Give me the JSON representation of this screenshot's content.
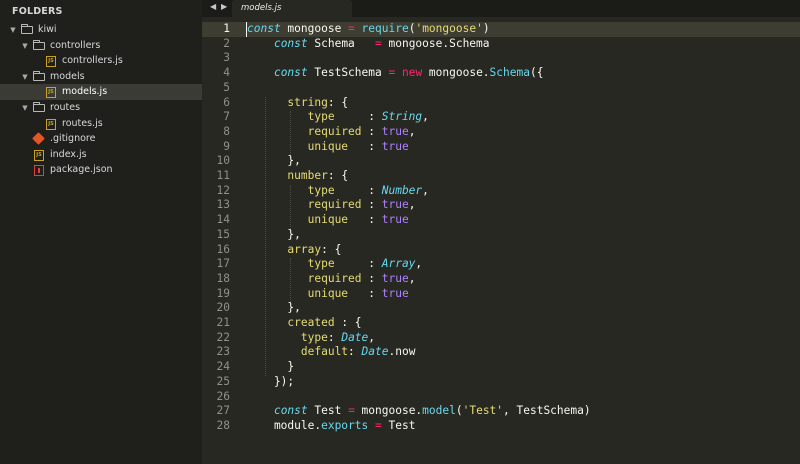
{
  "sidebar": {
    "title": "FOLDERS",
    "tree": [
      {
        "label": "kiwi",
        "kind": "folder",
        "depth": 0,
        "expanded": true,
        "selected": false
      },
      {
        "label": "controllers",
        "kind": "folder",
        "depth": 1,
        "expanded": true,
        "selected": false
      },
      {
        "label": "controllers.js",
        "kind": "js",
        "depth": 2,
        "selected": false
      },
      {
        "label": "models",
        "kind": "folder",
        "depth": 1,
        "expanded": true,
        "selected": false
      },
      {
        "label": "models.js",
        "kind": "js",
        "depth": 2,
        "selected": true
      },
      {
        "label": "routes",
        "kind": "folder",
        "depth": 1,
        "expanded": true,
        "selected": false
      },
      {
        "label": "routes.js",
        "kind": "js",
        "depth": 2,
        "selected": false
      },
      {
        "label": ".gitignore",
        "kind": "git",
        "depth": 1,
        "selected": false
      },
      {
        "label": "index.js",
        "kind": "js",
        "depth": 1,
        "selected": false
      },
      {
        "label": "package.json",
        "kind": "json",
        "depth": 1,
        "selected": false
      }
    ]
  },
  "tabbar": {
    "back_icon": "◀",
    "forward_icon": "▶",
    "tab_label": "models.js"
  },
  "editor": {
    "current_line": 1,
    "lines": [
      [
        [
          "kw-i",
          "const"
        ],
        [
          "plain",
          " mongoose "
        ],
        [
          "op",
          "="
        ],
        [
          "plain",
          " "
        ],
        [
          "fn",
          "require"
        ],
        [
          "plain",
          "("
        ],
        [
          "str",
          "'mongoose'"
        ],
        [
          "plain",
          ")"
        ]
      ],
      [
        [
          "plain",
          "    "
        ],
        [
          "kw-i",
          "const"
        ],
        [
          "plain",
          " Schema   "
        ],
        [
          "op",
          "="
        ],
        [
          "plain",
          " mongoose.Schema"
        ]
      ],
      [
        [
          "plain",
          ""
        ]
      ],
      [
        [
          "plain",
          "    "
        ],
        [
          "kw-i",
          "const"
        ],
        [
          "plain",
          " TestSchema "
        ],
        [
          "op",
          "="
        ],
        [
          "plain",
          " "
        ],
        [
          "kw",
          "new"
        ],
        [
          "plain",
          " mongoose."
        ],
        [
          "fn",
          "Schema"
        ],
        [
          "plain",
          "({"
        ]
      ],
      [
        [
          "plain",
          ""
        ]
      ],
      [
        [
          "plain",
          "      "
        ],
        [
          "key",
          "string"
        ],
        [
          "plain",
          ": {"
        ]
      ],
      [
        [
          "plain",
          "         "
        ],
        [
          "key",
          "type"
        ],
        [
          "plain",
          "     : "
        ],
        [
          "type",
          "String"
        ],
        [
          "plain",
          ","
        ]
      ],
      [
        [
          "plain",
          "         "
        ],
        [
          "key",
          "required"
        ],
        [
          "plain",
          " : "
        ],
        [
          "bool",
          "true"
        ],
        [
          "plain",
          ","
        ]
      ],
      [
        [
          "plain",
          "         "
        ],
        [
          "key",
          "unique"
        ],
        [
          "plain",
          "   : "
        ],
        [
          "bool",
          "true"
        ]
      ],
      [
        [
          "plain",
          "      },"
        ]
      ],
      [
        [
          "plain",
          "      "
        ],
        [
          "key",
          "number"
        ],
        [
          "plain",
          ": {"
        ]
      ],
      [
        [
          "plain",
          "         "
        ],
        [
          "key",
          "type"
        ],
        [
          "plain",
          "     : "
        ],
        [
          "type",
          "Number"
        ],
        [
          "plain",
          ","
        ]
      ],
      [
        [
          "plain",
          "         "
        ],
        [
          "key",
          "required"
        ],
        [
          "plain",
          " : "
        ],
        [
          "bool",
          "true"
        ],
        [
          "plain",
          ","
        ]
      ],
      [
        [
          "plain",
          "         "
        ],
        [
          "key",
          "unique"
        ],
        [
          "plain",
          "   : "
        ],
        [
          "bool",
          "true"
        ]
      ],
      [
        [
          "plain",
          "      },"
        ]
      ],
      [
        [
          "plain",
          "      "
        ],
        [
          "key",
          "array"
        ],
        [
          "plain",
          ": {"
        ]
      ],
      [
        [
          "plain",
          "         "
        ],
        [
          "key",
          "type"
        ],
        [
          "plain",
          "     : "
        ],
        [
          "type",
          "Array"
        ],
        [
          "plain",
          ","
        ]
      ],
      [
        [
          "plain",
          "         "
        ],
        [
          "key",
          "required"
        ],
        [
          "plain",
          " : "
        ],
        [
          "bool",
          "true"
        ],
        [
          "plain",
          ","
        ]
      ],
      [
        [
          "plain",
          "         "
        ],
        [
          "key",
          "unique"
        ],
        [
          "plain",
          "   : "
        ],
        [
          "bool",
          "true"
        ]
      ],
      [
        [
          "plain",
          "      },"
        ]
      ],
      [
        [
          "plain",
          "      "
        ],
        [
          "key",
          "created"
        ],
        [
          "plain",
          " : {"
        ]
      ],
      [
        [
          "plain",
          "        "
        ],
        [
          "key",
          "type"
        ],
        [
          "plain",
          ": "
        ],
        [
          "type",
          "Date"
        ],
        [
          "plain",
          ","
        ]
      ],
      [
        [
          "plain",
          "        "
        ],
        [
          "key",
          "default"
        ],
        [
          "plain",
          ": "
        ],
        [
          "type",
          "Date"
        ],
        [
          "plain",
          "."
        ],
        [
          "prop",
          "now"
        ]
      ],
      [
        [
          "plain",
          "      }"
        ]
      ],
      [
        [
          "plain",
          "    });"
        ]
      ],
      [
        [
          "plain",
          ""
        ]
      ],
      [
        [
          "plain",
          "    "
        ],
        [
          "kw-i",
          "const"
        ],
        [
          "plain",
          " Test "
        ],
        [
          "op",
          "="
        ],
        [
          "plain",
          " mongoose."
        ],
        [
          "fn",
          "model"
        ],
        [
          "plain",
          "("
        ],
        [
          "str",
          "'Test'"
        ],
        [
          "plain",
          ", TestSchema)"
        ]
      ],
      [
        [
          "plain",
          "    module."
        ],
        [
          "fn",
          "exports"
        ],
        [
          "plain",
          " "
        ],
        [
          "op",
          "="
        ],
        [
          "plain",
          " Test"
        ]
      ]
    ]
  },
  "colors": {
    "background": "#272822",
    "sidebar": "#1f201c",
    "keyword": "#f92672",
    "function": "#66d9ef",
    "string": "#e6db74",
    "boolean": "#ae81ff"
  }
}
